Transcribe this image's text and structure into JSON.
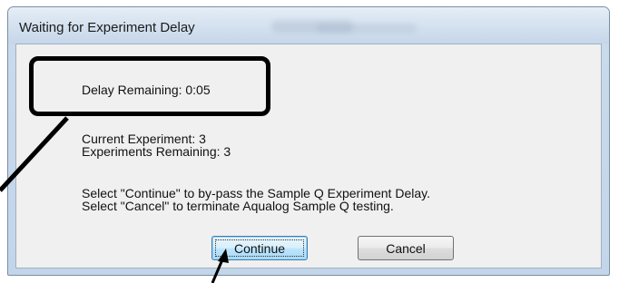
{
  "window": {
    "title": "Waiting for Experiment Delay"
  },
  "status": {
    "delay_remaining": "Delay Remaining: 0:05",
    "current_experiment": "Current Experiment: 3",
    "experiments_remaining": "Experiments Remaining: 3"
  },
  "instructions": {
    "line1": "Select \"Continue\" to by-pass the Sample Q Experiment Delay.",
    "line2": "Select \"Cancel\" to terminate Aqualog Sample Q testing."
  },
  "buttons": {
    "continue_label": "Continue",
    "cancel_label": "Cancel"
  },
  "annotation": {
    "color": "#000000"
  }
}
